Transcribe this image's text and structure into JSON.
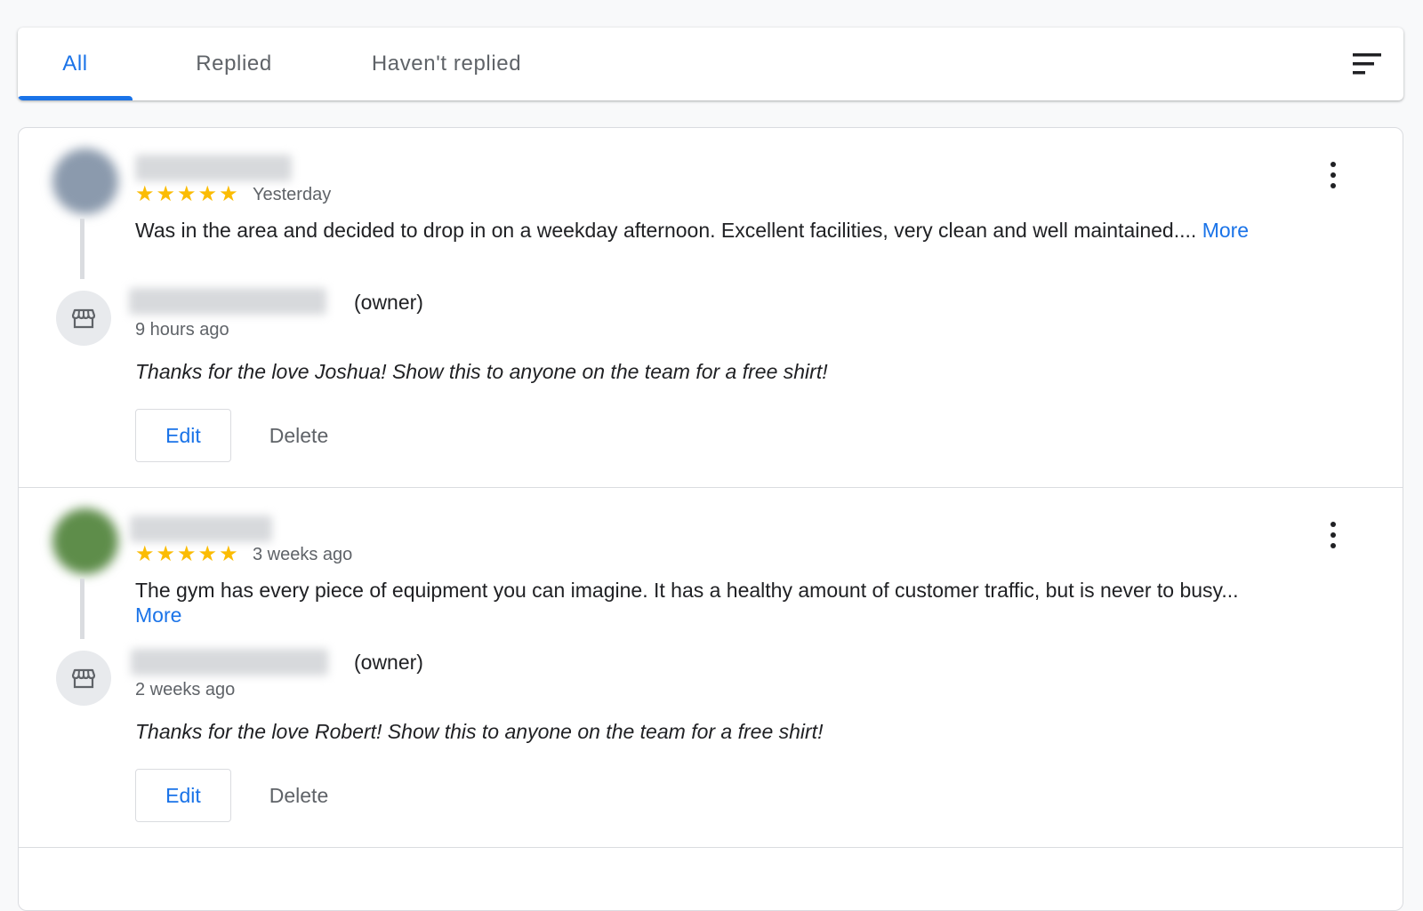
{
  "tabs": [
    {
      "label": "All",
      "active": true
    },
    {
      "label": "Replied",
      "active": false
    },
    {
      "label": "Haven't replied",
      "active": false
    }
  ],
  "icons": {
    "sort": "sort-icon",
    "more": "more-vert-icon",
    "owner": "storefront-icon"
  },
  "colors": {
    "accent": "#1a73e8",
    "star": "#fbbc04",
    "muted": "#5f6368"
  },
  "reviews": [
    {
      "rating": 5,
      "stars": "★★★★★",
      "time": "Yesterday",
      "text": "Was in the area and decided to drop in on a weekday afternoon. Excellent facilities, very clean and well maintained....",
      "more_label": "More",
      "avatar_color": "#8b9aad",
      "reply": {
        "owner_suffix": "(owner)",
        "time": "9 hours ago",
        "text": "Thanks for the love Joshua! Show this to anyone on the team for a free shirt!",
        "edit_label": "Edit",
        "delete_label": "Delete"
      }
    },
    {
      "rating": 5,
      "stars": "★★★★★",
      "time": "3 weeks ago",
      "text": "The gym has every piece of equipment you can imagine. It has a healthy amount of customer traffic, but is never to busy...",
      "more_label": "More",
      "avatar_color": "#5e8d4a",
      "reply": {
        "owner_suffix": "(owner)",
        "time": "2 weeks ago",
        "text": "Thanks for the love Robert! Show this to anyone on the team for a free shirt!",
        "edit_label": "Edit",
        "delete_label": "Delete"
      }
    }
  ]
}
